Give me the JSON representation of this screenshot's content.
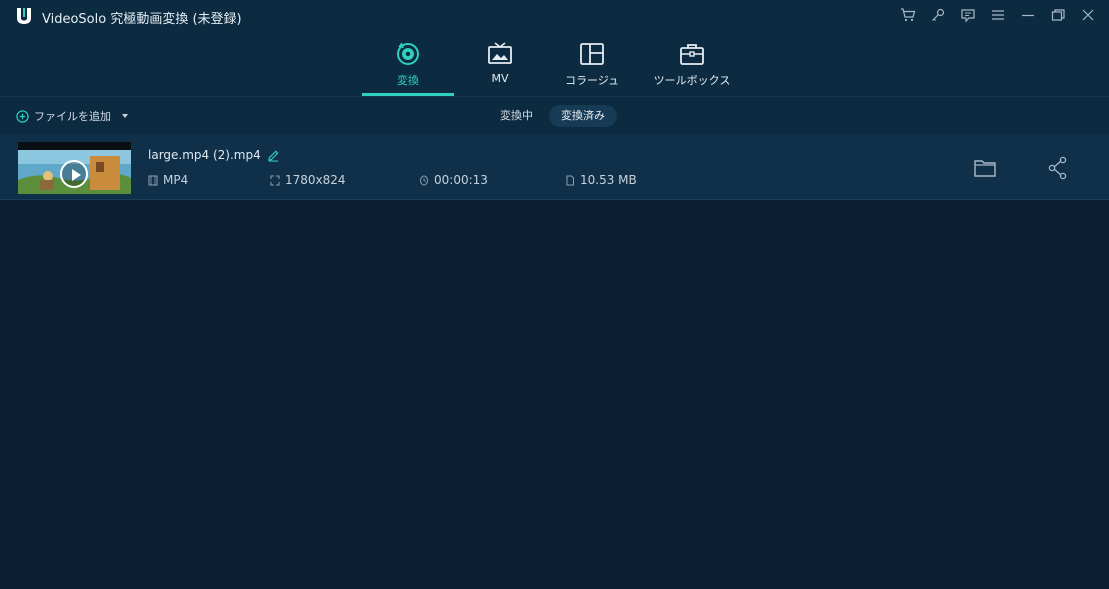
{
  "app": {
    "title": "VideoSolo 究極動画変換 (未登録)"
  },
  "nav": {
    "tabs": [
      {
        "label": "変換",
        "icon": "convert-icon",
        "active": true
      },
      {
        "label": "MV",
        "icon": "mv-icon",
        "active": false
      },
      {
        "label": "コラージュ",
        "icon": "collage-icon",
        "active": false
      },
      {
        "label": "ツールボックス",
        "icon": "toolbox-icon",
        "active": false
      }
    ]
  },
  "toolbar": {
    "add_file_label": "ファイルを追加",
    "segments": [
      {
        "label": "変換中",
        "active": false
      },
      {
        "label": "変換済み",
        "active": true
      }
    ]
  },
  "files": [
    {
      "name": "large.mp4 (2).mp4",
      "format": "MP4",
      "resolution": "1780x824",
      "duration": "00:00:13",
      "size": "10.53 MB"
    }
  ],
  "colors": {
    "accent": "#2fd0c0",
    "background": "#0b1f33",
    "header": "#0c2a40",
    "row": "#10304a"
  }
}
